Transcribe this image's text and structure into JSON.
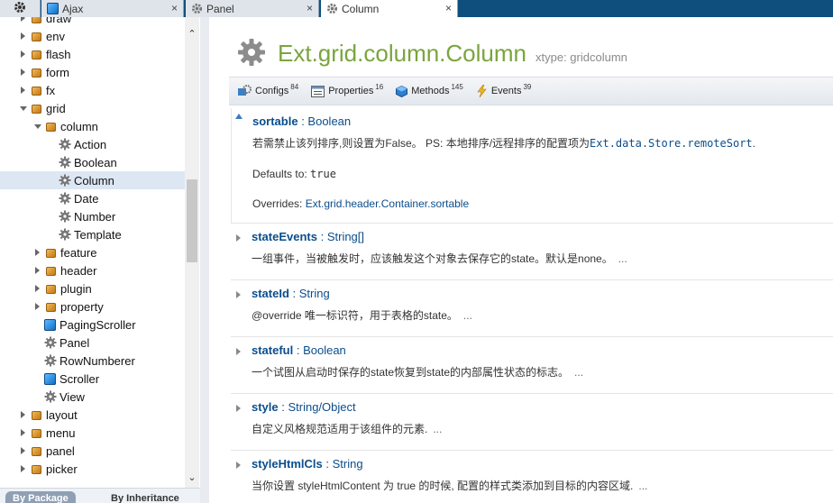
{
  "tabs": [
    {
      "label": "Ajax",
      "icon": "class-icon",
      "close": "×"
    },
    {
      "label": "Panel",
      "icon": "gear-icon",
      "close": "×"
    },
    {
      "label": "Column",
      "icon": "gear-icon",
      "close": "×"
    }
  ],
  "tree": [
    {
      "label": "draw",
      "type": "package",
      "expander": "right",
      "indent": 0
    },
    {
      "label": "env",
      "type": "package",
      "expander": "right",
      "indent": 0
    },
    {
      "label": "flash",
      "type": "package",
      "expander": "right",
      "indent": 0
    },
    {
      "label": "form",
      "type": "package",
      "expander": "right",
      "indent": 0
    },
    {
      "label": "fx",
      "type": "package",
      "expander": "right",
      "indent": 0
    },
    {
      "label": "grid",
      "type": "package",
      "expander": "down",
      "indent": 0
    },
    {
      "label": "column",
      "type": "package",
      "expander": "down",
      "indent": 1
    },
    {
      "label": "Action",
      "type": "component",
      "expander": "none",
      "indent": 2
    },
    {
      "label": "Boolean",
      "type": "component",
      "expander": "none",
      "indent": 2
    },
    {
      "label": "Column",
      "type": "component",
      "expander": "none",
      "indent": 2,
      "selected": true
    },
    {
      "label": "Date",
      "type": "component",
      "expander": "none",
      "indent": 2
    },
    {
      "label": "Number",
      "type": "component",
      "expander": "none",
      "indent": 2
    },
    {
      "label": "Template",
      "type": "component",
      "expander": "none",
      "indent": 2
    },
    {
      "label": "feature",
      "type": "package",
      "expander": "right",
      "indent": 1
    },
    {
      "label": "header",
      "type": "package",
      "expander": "right",
      "indent": 1
    },
    {
      "label": "plugin",
      "type": "package",
      "expander": "right",
      "indent": 1
    },
    {
      "label": "property",
      "type": "package",
      "expander": "right",
      "indent": 1
    },
    {
      "label": "PagingScroller",
      "type": "class",
      "expander": "none",
      "indent": 1
    },
    {
      "label": "Panel",
      "type": "component",
      "expander": "none",
      "indent": 1
    },
    {
      "label": "RowNumberer",
      "type": "component",
      "expander": "none",
      "indent": 1
    },
    {
      "label": "Scroller",
      "type": "class",
      "expander": "none",
      "indent": 1
    },
    {
      "label": "View",
      "type": "component",
      "expander": "none",
      "indent": 1
    },
    {
      "label": "layout",
      "type": "package",
      "expander": "right",
      "indent": 0
    },
    {
      "label": "menu",
      "type": "package",
      "expander": "right",
      "indent": 0
    },
    {
      "label": "panel",
      "type": "package",
      "expander": "right",
      "indent": 0
    },
    {
      "label": "picker",
      "type": "package",
      "expander": "right",
      "indent": 0
    }
  ],
  "bottom_tabs": {
    "by_package": "By Package",
    "by_inheritance": "By Inheritance"
  },
  "header": {
    "title": "Ext.grid.column.Column",
    "xtype": "xtype: gridcolumn"
  },
  "toolbar": [
    {
      "label": "Configs",
      "count": "84",
      "icon": "configs-icon"
    },
    {
      "label": "Properties",
      "count": "16",
      "icon": "properties-icon"
    },
    {
      "label": "Methods",
      "count": "145",
      "icon": "methods-icon"
    },
    {
      "label": "Events",
      "count": "39",
      "icon": "events-icon"
    }
  ],
  "members": {
    "sortable": {
      "name": "sortable",
      "sep": " : ",
      "type": "Boolean",
      "desc_prefix": "若需禁止该列排序,则设置为False。 PS: 本地排序/远程排序的配置项为",
      "desc_code": "Ext.data.Store.remoteSort",
      "desc_suffix": ".",
      "defaults_label": "Defaults to: ",
      "defaults_value": "true",
      "overrides_label": "Overrides: ",
      "overrides_link": "Ext.grid.header.Container.sortable"
    },
    "stateEvents": {
      "name": "stateEvents",
      "sep": " : ",
      "type": "String[]",
      "desc": "一组事件，当被触发时，应该触发这个对象去保存它的state。默认是none。",
      "more": "..."
    },
    "stateId": {
      "name": "stateId",
      "sep": " : ",
      "type": "String",
      "desc": "@override 唯一标识符，用于表格的state。",
      "more": "..."
    },
    "stateful": {
      "name": "stateful",
      "sep": " : ",
      "type": "Boolean",
      "desc": "一个试图从启动时保存的state恢复到state的内部属性状态的标志。",
      "more": "..."
    },
    "style": {
      "name": "style",
      "sep": " : ",
      "type": "String/Object",
      "desc": "自定义风格规范适用于该组件的元素.",
      "more": "..."
    },
    "styleHtmlCls": {
      "name": "styleHtmlCls",
      "sep": " : ",
      "type": "String",
      "desc": "当你设置 styleHtmlContent 为 true 的时候, 配置的样式类添加到目标的内容区域.",
      "more": "..."
    }
  }
}
